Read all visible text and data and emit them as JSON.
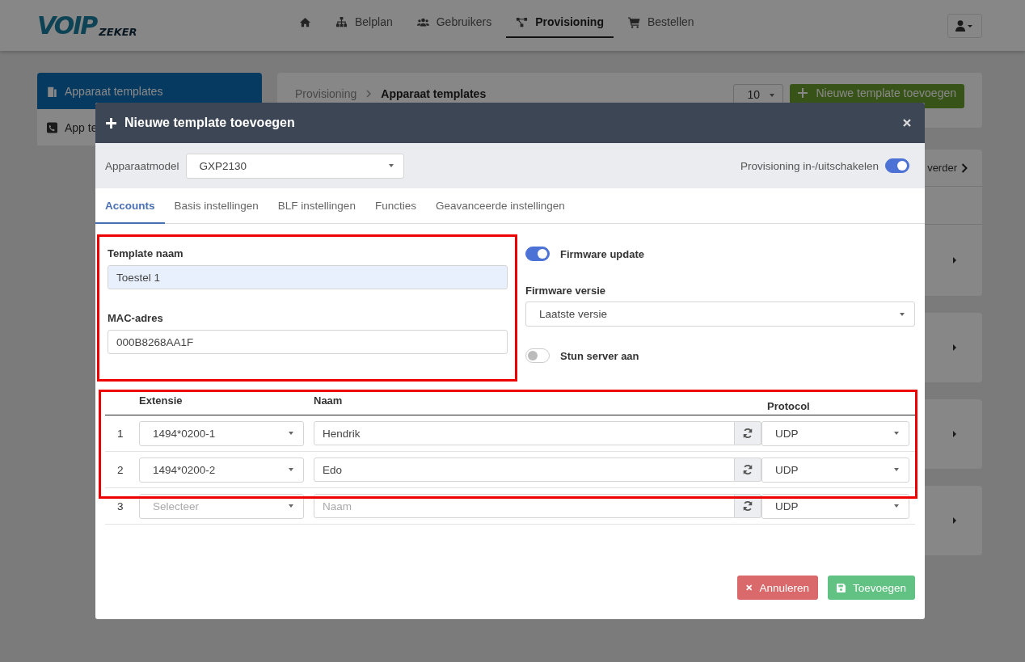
{
  "navbar": {
    "logo": {
      "main": "VOIP",
      "sub": "ZEKER"
    },
    "items": [
      {
        "kind": "home",
        "selected": false
      },
      {
        "kind": "sitemap",
        "label": "Belplan",
        "selected": false
      },
      {
        "kind": "users",
        "label": "Gebruikers",
        "selected": false
      },
      {
        "kind": "network",
        "label": "Provisioning",
        "selected": true
      },
      {
        "kind": "cart",
        "label": "Bestellen",
        "selected": false
      }
    ]
  },
  "sidebar": {
    "items": [
      {
        "kind": "building",
        "label": "Apparaat templates",
        "selected": true
      },
      {
        "kind": "phone",
        "label": "App te",
        "selected": false
      }
    ]
  },
  "breadcrumb": [
    "Provisioning",
    "Apparaat templates"
  ],
  "page_size": "10",
  "add_button": "Nieuwe template toevoegen",
  "list": {
    "link": "verder"
  },
  "modal": {
    "title": "Nieuwe template toevoegen",
    "model_label": "Apparaatmodel",
    "model": "GXP2130",
    "provisioning": {
      "label": "Provisioning in-/uitschakelen",
      "on": true
    },
    "tabs": [
      {
        "label": "Accounts",
        "selected": true
      },
      {
        "label": "Basis instellingen",
        "selected": false
      },
      {
        "label": "BLF instellingen",
        "selected": false
      },
      {
        "label": "Functies",
        "selected": false
      },
      {
        "label": "Geavanceerde instellingen",
        "selected": false
      }
    ],
    "fields_highlighted": true,
    "template_name": {
      "label": "Template naam",
      "value": "Toestel 1"
    },
    "mac": {
      "label": "MAC-adres",
      "value": "000B8268AA1F"
    },
    "firmware_update": {
      "label": "Firmware update",
      "on": true
    },
    "firmware_version": {
      "label": "Firmware versie",
      "value": "Laatste versie"
    },
    "stun": {
      "label": "Stun server aan",
      "on": false
    },
    "table_highlighted": true,
    "columns": [
      "Extensie",
      "Naam",
      "Protocol"
    ],
    "rows": [
      {
        "index": "1",
        "extension": "1494*0200-1",
        "name": "Hendrik",
        "protocol": "UDP"
      },
      {
        "index": "2",
        "extension": "1494*0200-2",
        "name": "Edo",
        "protocol": "UDP"
      },
      {
        "index": "3",
        "extension_placeholder": "Selecteer",
        "name_placeholder": "Naam",
        "protocol": "UDP"
      }
    ],
    "cancel": "Annuleren",
    "submit": "Toevoegen"
  }
}
